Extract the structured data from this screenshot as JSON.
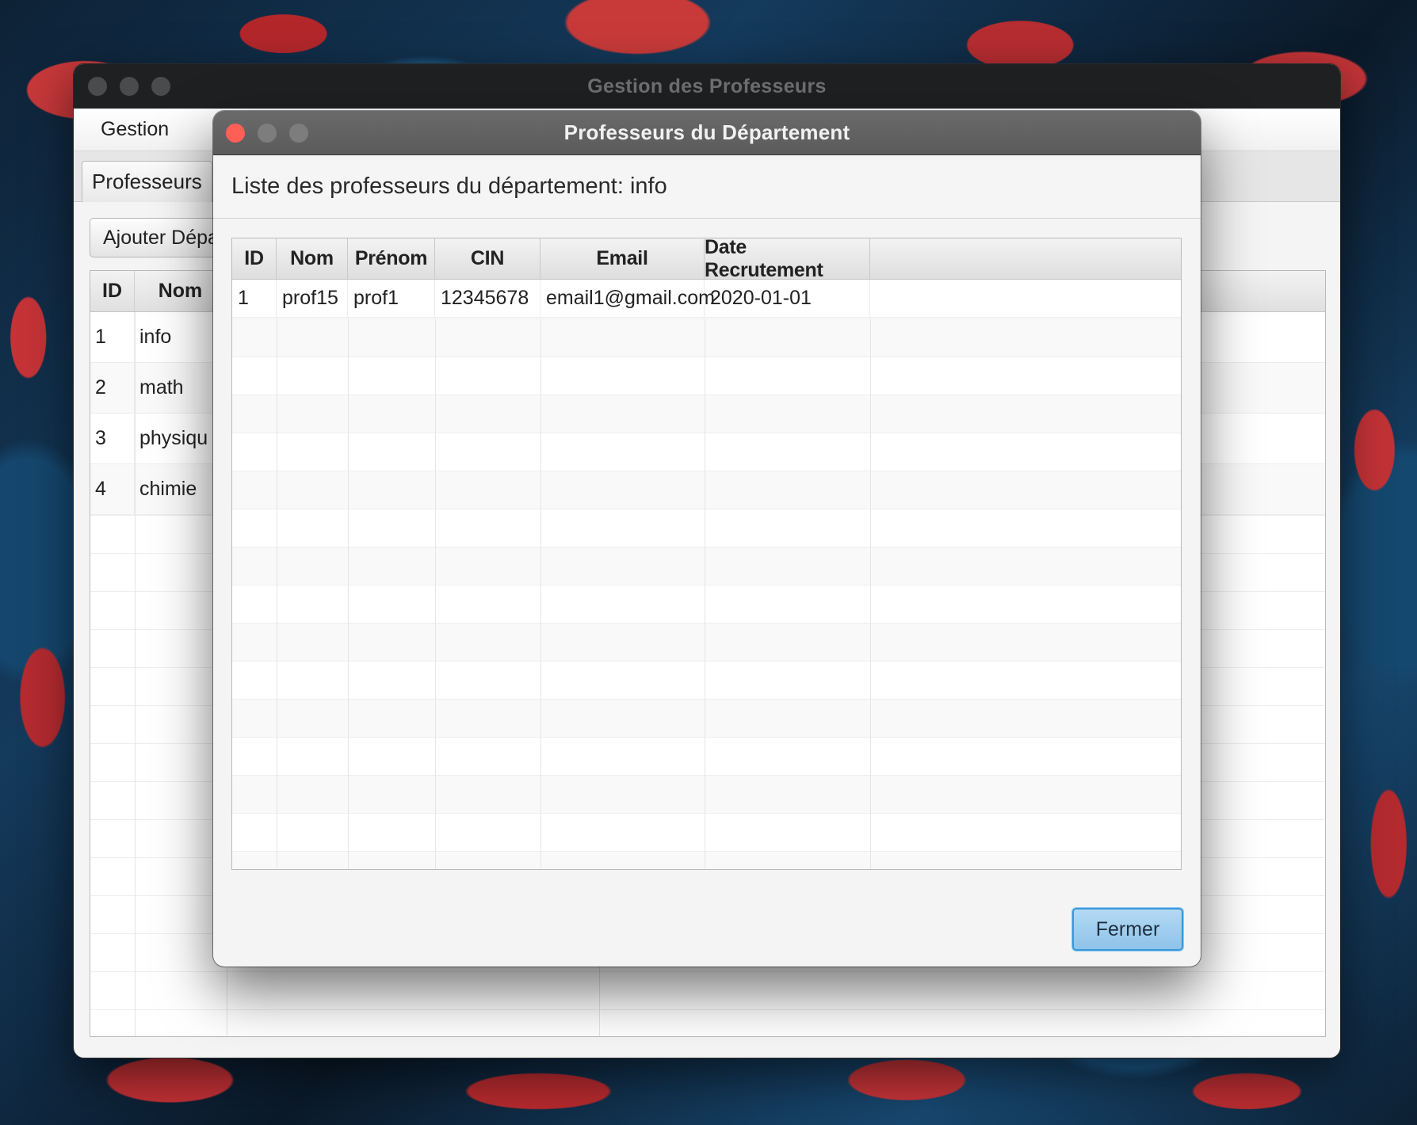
{
  "main_window": {
    "title": "Gestion des Professeurs",
    "menu": [
      "Gestion"
    ],
    "tabs": [
      {
        "label": "Professeurs"
      },
      {
        "label": ""
      }
    ],
    "add_button_label": "Ajouter Dépa",
    "dept_table": {
      "columns": [
        "ID",
        "Nom"
      ],
      "rows": [
        {
          "id": "1",
          "nom": "info"
        },
        {
          "id": "2",
          "nom": "math"
        },
        {
          "id": "3",
          "nom": "physiqu"
        },
        {
          "id": "4",
          "nom": "chimie"
        }
      ]
    }
  },
  "dialog": {
    "title": "Professeurs du Département",
    "header": "Liste des professeurs du département: info",
    "table": {
      "columns": [
        "ID",
        "Nom",
        "Prénom",
        "CIN",
        "Email",
        "Date Recrutement"
      ],
      "rows": [
        {
          "id": "1",
          "nom": "prof15",
          "prenom": "prof1",
          "cin": "12345678",
          "email": "email1@gmail.com",
          "date": "2020-01-01"
        }
      ]
    },
    "close_button_label": "Fermer"
  },
  "colors": {
    "accent_button": "#8ec3e9",
    "close_light": "#ff5f57"
  }
}
